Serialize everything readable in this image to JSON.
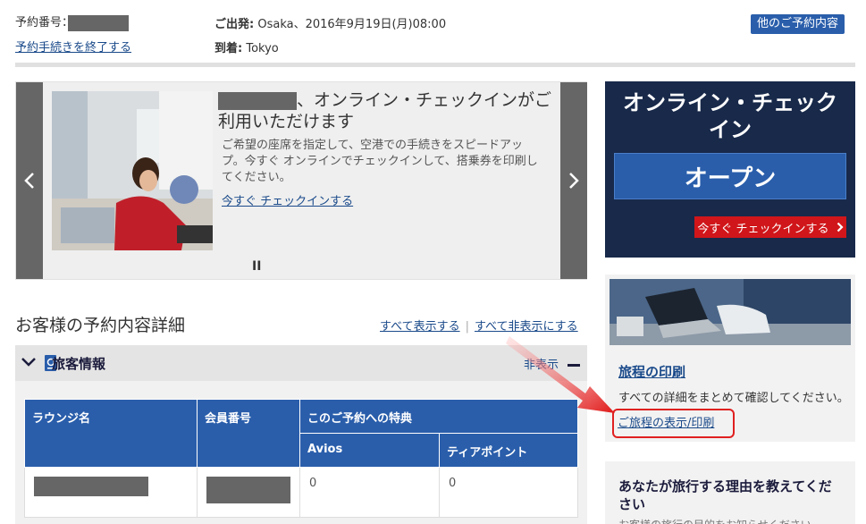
{
  "header": {
    "booking_ref_label": "予約番号：",
    "end_booking_link": "予約手続きを終了する",
    "departure_label": "ご出発:",
    "departure_value": "Osaka、2016年9月19日(月)08:00",
    "arrival_label": "到着:",
    "arrival_value": "Tokyo",
    "other_bookings_button": "他のご予約内容"
  },
  "carousel": {
    "title_suffix": "、オンライン・チェックインがご利用いただけます",
    "description": "ご希望の座席を指定して、空港での手続きをスピードアップ。今すぐ オンラインでチェックインして、搭乗券を印刷してください。",
    "link": "今すぐ チェックインする",
    "pause": "II"
  },
  "section": {
    "title": "お客様の予約内容詳細",
    "show_all": "すべて表示する",
    "hide_all": "すべて非表示にする"
  },
  "passenger": {
    "title": "旅客情報",
    "hide_label": "非表示",
    "table": {
      "col_lounge": "ラウンジ名",
      "col_member": "会員番号",
      "col_benefit": "このご予約への特典",
      "col_avios": "Avios",
      "col_tier": "ティアポイント",
      "avios_value": "0",
      "tier_value": "0"
    }
  },
  "checkin": {
    "title": "オンライン・チェックイン",
    "open_button": "オープン",
    "checkin_now_button": "今すぐ チェックインする"
  },
  "itinerary": {
    "title": "旅程の印刷",
    "description": "すべての詳細をまとめて確認してください。",
    "link": "ご旅程の表示/印刷"
  },
  "reason": {
    "title": "あなたが旅行する理由を教えてください",
    "subtitle": "お客様の旅行の目的をお知らせください"
  },
  "colors": {
    "brand_blue": "#2a5eab",
    "navy": "#18294a",
    "red": "#d0161a",
    "annotation_red": "#e02020"
  }
}
